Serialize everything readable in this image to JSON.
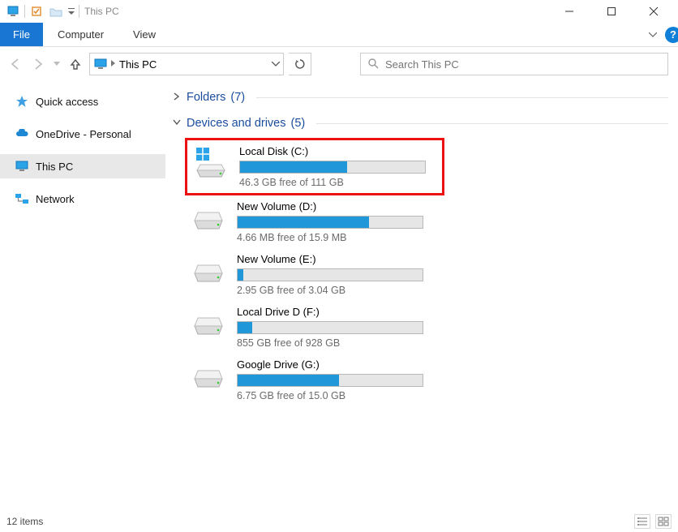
{
  "titlebar": {
    "title": "This PC"
  },
  "ribbon": {
    "file": "File",
    "tabs": [
      "Computer",
      "View"
    ]
  },
  "address": {
    "location": "This PC"
  },
  "search": {
    "placeholder": "Search This PC"
  },
  "sidebar": {
    "items": [
      {
        "label": "Quick access",
        "icon": "star"
      },
      {
        "label": "OneDrive - Personal",
        "icon": "cloud"
      },
      {
        "label": "This PC",
        "icon": "monitor",
        "selected": true
      },
      {
        "label": "Network",
        "icon": "network"
      }
    ]
  },
  "groups": {
    "folders": {
      "label": "Folders",
      "count": "(7)",
      "expanded": false
    },
    "drives": {
      "label": "Devices and drives",
      "count": "(5)",
      "expanded": true
    }
  },
  "drives": [
    {
      "name": "Local Disk (C:)",
      "freeText": "46.3 GB free of 111 GB",
      "fillPct": 58,
      "icon": "osdisk",
      "highlight": true
    },
    {
      "name": "New Volume (D:)",
      "freeText": "4.66 MB free of 15.9 MB",
      "fillPct": 71,
      "icon": "disk"
    },
    {
      "name": "New Volume (E:)",
      "freeText": "2.95 GB free of 3.04 GB",
      "fillPct": 3,
      "icon": "disk"
    },
    {
      "name": "Local Drive D (F:)",
      "freeText": "855 GB free of 928 GB",
      "fillPct": 8,
      "icon": "disk"
    },
    {
      "name": "Google Drive (G:)",
      "freeText": "6.75 GB free of 15.0 GB",
      "fillPct": 55,
      "icon": "disk"
    }
  ],
  "status": {
    "items": "12 items"
  }
}
